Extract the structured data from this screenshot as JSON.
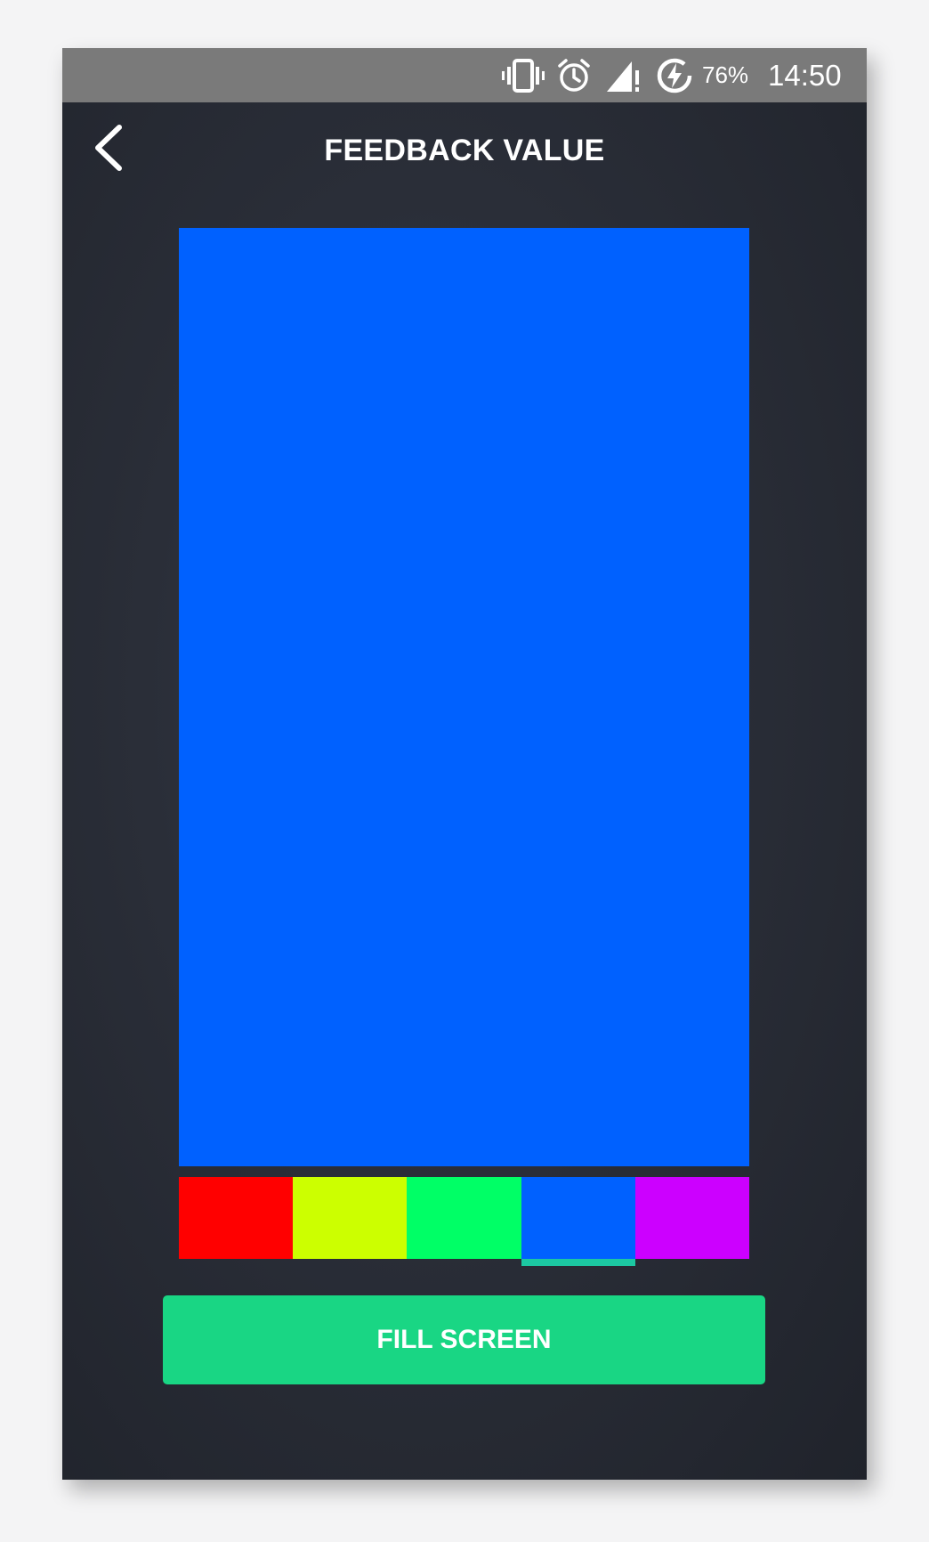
{
  "status_bar": {
    "battery_percent": "76%",
    "time": "14:50",
    "icons": [
      "vibrate-icon",
      "alarm-icon",
      "signal-icon",
      "battery-saver-icon"
    ]
  },
  "header": {
    "title": "FEEDBACK VALUE",
    "back_icon": "chevron-left-icon"
  },
  "preview": {
    "color": "#0061ff"
  },
  "swatches": [
    {
      "color": "#ff0000",
      "selected": false
    },
    {
      "color": "#ccff00",
      "selected": false
    },
    {
      "color": "#00ff66",
      "selected": false
    },
    {
      "color": "#0061ff",
      "selected": true
    },
    {
      "color": "#cc00ff",
      "selected": false
    }
  ],
  "action": {
    "fill_label": "FILL SCREEN",
    "accent_color": "#19d684"
  }
}
